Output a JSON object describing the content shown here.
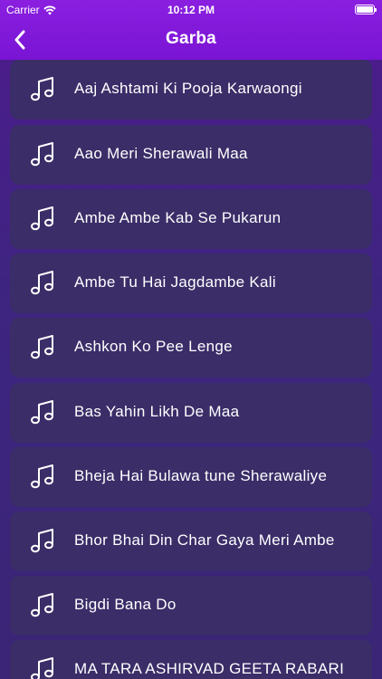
{
  "status": {
    "carrier": "Carrier",
    "time": "10:12 PM"
  },
  "nav": {
    "title": "Garba"
  },
  "songs": [
    {
      "title": "Aaj Ashtami Ki Pooja Karwaongi"
    },
    {
      "title": "Aao Meri Sherawali Maa"
    },
    {
      "title": "Ambe Ambe Kab Se Pukarun"
    },
    {
      "title": "Ambe Tu Hai Jagdambe Kali"
    },
    {
      "title": "Ashkon Ko Pee Lenge"
    },
    {
      "title": "Bas Yahin Likh De Maa"
    },
    {
      "title": "Bheja Hai Bulawa tune Sherawaliye"
    },
    {
      "title": "Bhor Bhai Din Char Gaya Meri Ambe"
    },
    {
      "title": "Bigdi Bana Do"
    },
    {
      "title": "MA TARA ASHIRVAD  GEETA RABARI"
    }
  ],
  "icons": {
    "song": "music-note-icon",
    "back": "chevron-left-icon",
    "wifi": "wifi-icon",
    "battery": "battery-icon"
  }
}
